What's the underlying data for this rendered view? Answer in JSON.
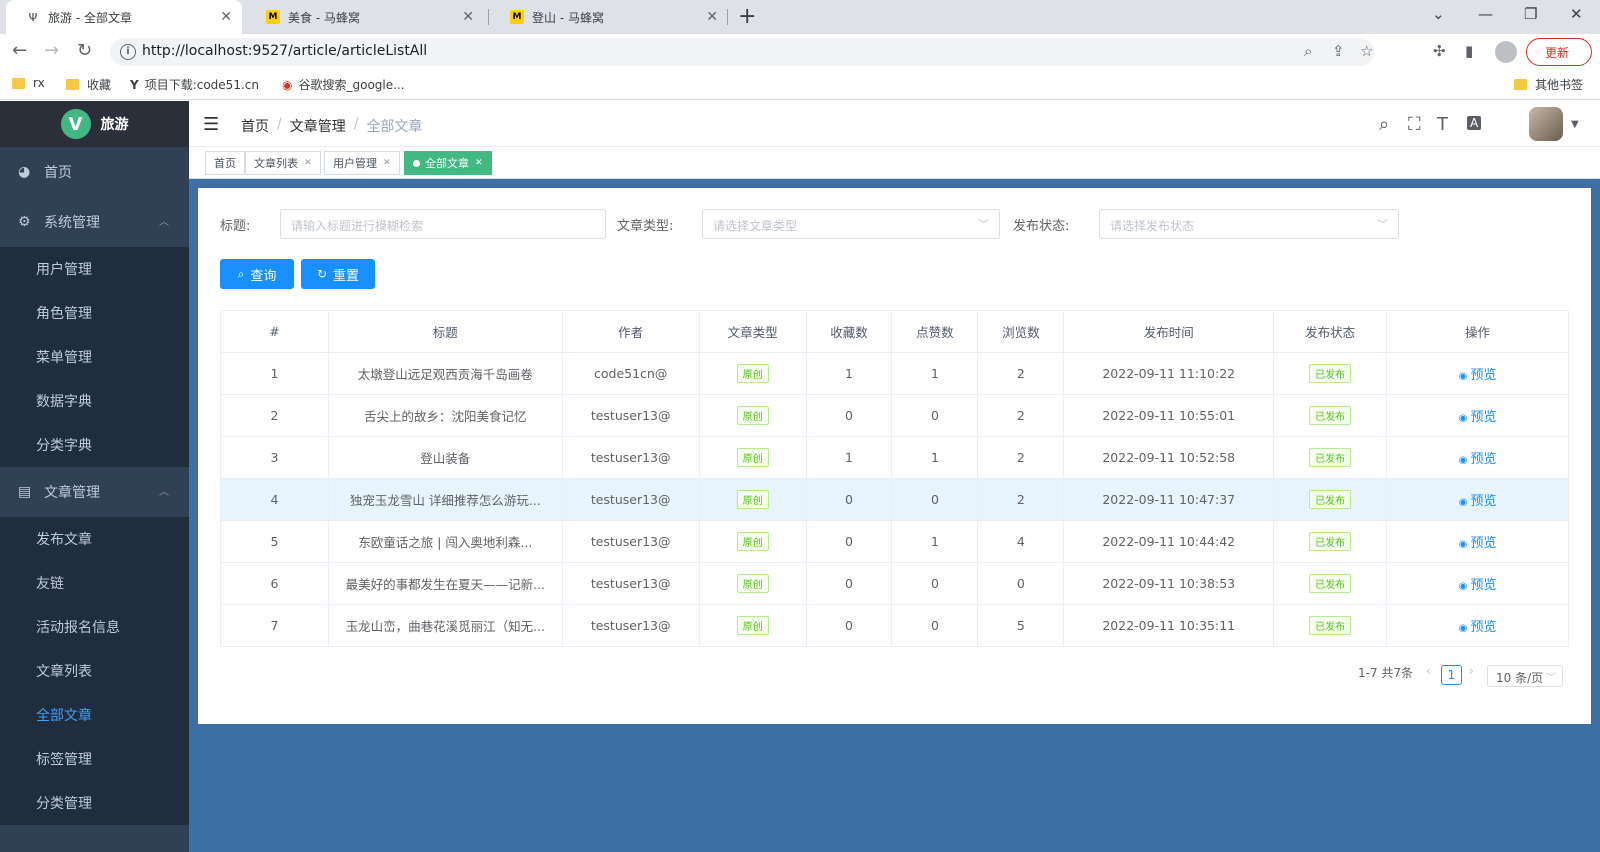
{
  "browser": {
    "tabs": [
      {
        "title": "旅游 - 全部文章",
        "favicon": "Y"
      },
      {
        "title": "美食 - 马蜂窝",
        "favicon": "M"
      },
      {
        "title": "登山 - 马蜂窝",
        "favicon": "M"
      }
    ],
    "url": "http://localhost:9527/article/articleListAll",
    "update_label": "更新",
    "bookmarks": [
      "rx",
      "收藏",
      "项目下载:code51.cn",
      "谷歌搜索_google...",
      "其他书签"
    ]
  },
  "sidebar": {
    "logo_title": "旅游",
    "logo_letter": "V",
    "items": [
      {
        "label": "首页",
        "icon": "dashboard-icon"
      },
      {
        "label": "系统管理",
        "icon": "gear-icon",
        "children": [
          "用户管理",
          "角色管理",
          "菜单管理",
          "数据字典",
          "分类字典"
        ]
      },
      {
        "label": "文章管理",
        "icon": "document-icon",
        "children": [
          "发布文章",
          "友链",
          "活动报名信息",
          "文章列表",
          "全部文章",
          "标签管理",
          "分类管理"
        ]
      }
    ]
  },
  "header": {
    "breadcrumb": [
      "首页",
      "文章管理",
      "全部文章"
    ]
  },
  "tags": [
    "首页",
    "文章列表",
    "用户管理",
    "全部文章"
  ],
  "filters": {
    "title_label": "标题:",
    "title_placeholder": "请输入标题进行模糊检索",
    "type_label": "文章类型:",
    "type_placeholder": "请选择文章类型",
    "status_label": "发布状态:",
    "status_placeholder": "请选择发布状态",
    "query_label": "查询",
    "reset_label": "重置"
  },
  "table": {
    "columns": [
      "#",
      "标题",
      "作者",
      "文章类型",
      "收藏数",
      "点赞数",
      "浏览数",
      "发布时间",
      "发布状态",
      "操作"
    ],
    "rows": [
      {
        "no": "1",
        "title": "太墩登山远足观西贡海千岛画卷",
        "author": "code51cn@",
        "type": "原创",
        "fav": "1",
        "likes": "1",
        "views": "2",
        "time": "2022-09-11 11:10:22",
        "status": "已发布",
        "action": "预览"
      },
      {
        "no": "2",
        "title": "舌尖上的故乡：沈阳美食记忆",
        "author": "testuser13@",
        "type": "原创",
        "fav": "0",
        "likes": "0",
        "views": "2",
        "time": "2022-09-11 10:55:01",
        "status": "已发布",
        "action": "预览"
      },
      {
        "no": "3",
        "title": "登山装备",
        "author": "testuser13@",
        "type": "原创",
        "fav": "1",
        "likes": "1",
        "views": "2",
        "time": "2022-09-11 10:52:58",
        "status": "已发布",
        "action": "预览"
      },
      {
        "no": "4",
        "title": "独宠玉龙雪山 详细推荐怎么游玩...",
        "author": "testuser13@",
        "type": "原创",
        "fav": "0",
        "likes": "0",
        "views": "2",
        "time": "2022-09-11 10:47:37",
        "status": "已发布",
        "action": "预览"
      },
      {
        "no": "5",
        "title": "东欧童话之旅 | 闯入奥地利森...",
        "author": "testuser13@",
        "type": "原创",
        "fav": "0",
        "likes": "1",
        "views": "4",
        "time": "2022-09-11 10:44:42",
        "status": "已发布",
        "action": "预览"
      },
      {
        "no": "6",
        "title": "最美好的事都发生在夏天——记新...",
        "author": "testuser13@",
        "type": "原创",
        "fav": "0",
        "likes": "0",
        "views": "0",
        "time": "2022-09-11 10:38:53",
        "status": "已发布",
        "action": "预览"
      },
      {
        "no": "7",
        "title": "玉龙山峦，曲巷花溪觅丽江（知无...",
        "author": "testuser13@",
        "type": "原创",
        "fav": "0",
        "likes": "0",
        "views": "5",
        "time": "2022-09-11 10:35:11",
        "status": "已发布",
        "action": "预览"
      }
    ]
  },
  "pagination": {
    "total_text": "1-7 共7条",
    "current_page": "1",
    "page_size": "10 条/页"
  },
  "colors": {
    "sidebar_bg": "#304156",
    "submenu_bg": "#1f2d3d",
    "primary": "#1890ff",
    "main_bg": "#3d6fa5",
    "tag_active": "#42b983"
  }
}
